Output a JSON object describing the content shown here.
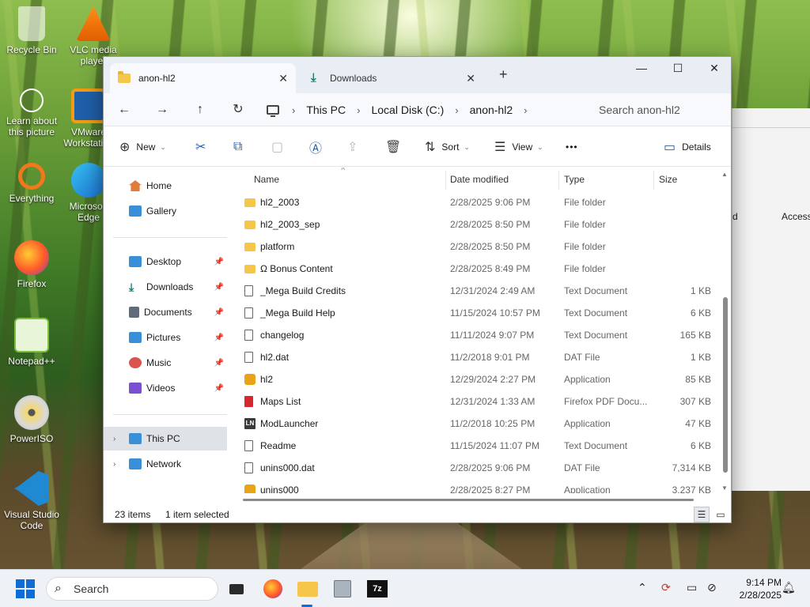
{
  "desktop": {
    "icons": [
      {
        "label": "Recycle Bin"
      },
      {
        "label": "VLC media player"
      },
      {
        "label": "Learn about this picture"
      },
      {
        "label": "VMware Workstation"
      },
      {
        "label": "Everything"
      },
      {
        "label": "Microsoft Edge"
      },
      {
        "label": "Firefox"
      },
      {
        "label": "Notepad++"
      },
      {
        "label": "PowerISO"
      },
      {
        "label": "Visual Studio Code"
      }
    ]
  },
  "explorer": {
    "tabs": [
      {
        "label": "anon-hl2",
        "active": true
      },
      {
        "label": "Downloads",
        "active": false
      }
    ],
    "window_controls": {
      "minimize": "—",
      "maximize": "☐",
      "close": "✕"
    },
    "breadcrumb": [
      "This PC",
      "Local Disk (C:)",
      "anon-hl2"
    ],
    "search_placeholder": "Search anon-hl2",
    "toolbar": {
      "new_label": "New",
      "sort_label": "Sort",
      "view_label": "View",
      "more_label": "•••",
      "details_label": "Details"
    },
    "nav": {
      "home": "Home",
      "gallery": "Gallery",
      "quick": [
        {
          "label": "Desktop",
          "color": "#3a8fd9"
        },
        {
          "label": "Downloads",
          "color": "#1a7f6e"
        },
        {
          "label": "Documents",
          "color": "#5f6b7a"
        },
        {
          "label": "Pictures",
          "color": "#3a8fd9"
        },
        {
          "label": "Music",
          "color": "#d9534f"
        },
        {
          "label": "Videos",
          "color": "#7b4fd0"
        }
      ],
      "this_pc": "This PC",
      "network": "Network"
    },
    "columns": {
      "name": "Name",
      "date": "Date modified",
      "type": "Type",
      "size": "Size"
    },
    "files": [
      {
        "name": "hl2_2003",
        "date": "2/28/2025 9:06 PM",
        "type": "File folder",
        "size": "",
        "icon": "folder"
      },
      {
        "name": "hl2_2003_sep",
        "date": "2/28/2025 8:50 PM",
        "type": "File folder",
        "size": "",
        "icon": "folder"
      },
      {
        "name": "platform",
        "date": "2/28/2025 8:50 PM",
        "type": "File folder",
        "size": "",
        "icon": "folder"
      },
      {
        "name": "Ω Bonus Content",
        "date": "2/28/2025 8:49 PM",
        "type": "File folder",
        "size": "",
        "icon": "folder"
      },
      {
        "name": "_Mega Build Credits",
        "date": "12/31/2024 2:49 AM",
        "type": "Text Document",
        "size": "1 KB",
        "icon": "doc"
      },
      {
        "name": "_Mega Build Help",
        "date": "11/15/2024 10:57 PM",
        "type": "Text Document",
        "size": "6 KB",
        "icon": "doc"
      },
      {
        "name": "changelog",
        "date": "11/11/2024 9:07 PM",
        "type": "Text Document",
        "size": "165 KB",
        "icon": "doc"
      },
      {
        "name": "hl2.dat",
        "date": "11/2/2018 9:01 PM",
        "type": "DAT File",
        "size": "1 KB",
        "icon": "doc"
      },
      {
        "name": "hl2",
        "date": "12/29/2024 2:27 PM",
        "type": "Application",
        "size": "85 KB",
        "icon": "app"
      },
      {
        "name": "Maps List",
        "date": "12/31/2024 1:33 AM",
        "type": "Firefox PDF Docu...",
        "size": "307 KB",
        "icon": "pdf"
      },
      {
        "name": "ModLauncher",
        "date": "11/2/2018 10:25 PM",
        "type": "Application",
        "size": "47 KB",
        "icon": "ln"
      },
      {
        "name": "Readme",
        "date": "11/15/2024 11:07 PM",
        "type": "Text Document",
        "size": "6 KB",
        "icon": "doc"
      },
      {
        "name": "unins000.dat",
        "date": "2/28/2025 9:06 PM",
        "type": "DAT File",
        "size": "7,314 KB",
        "icon": "doc"
      },
      {
        "name": "unins000",
        "date": "2/28/2025 8:27 PM",
        "type": "Application",
        "size": "3,237 KB",
        "icon": "app"
      }
    ],
    "status": {
      "items": "23 items",
      "selected": "1 item selected"
    }
  },
  "background_window": {
    "col1": "d",
    "col2": "Access"
  },
  "taskbar": {
    "search_label": "Search",
    "time": "9:14 PM",
    "date": "2/28/2025"
  },
  "colors": {
    "accent": "#0f6cd6",
    "folder": "#f5c64a"
  }
}
